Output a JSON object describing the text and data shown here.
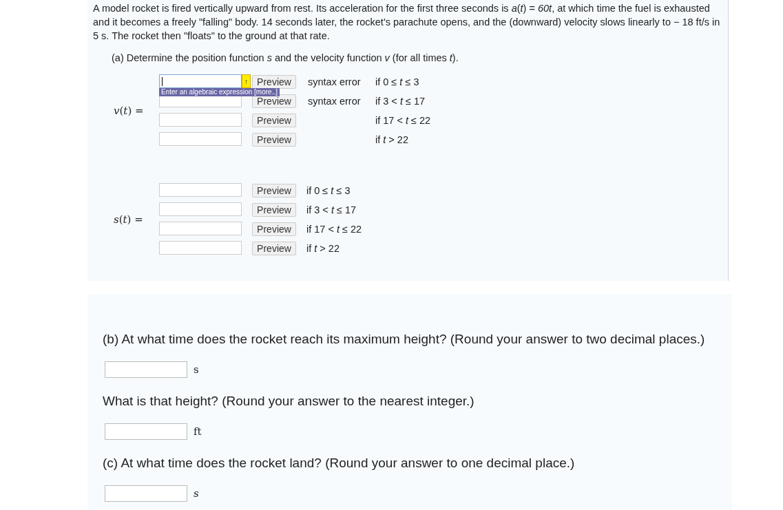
{
  "intro": "A model rocket is fired vertically upward from rest. Its acceleration for the first three seconds is *a*(*t*) = *60t*, at which time the fuel is exhausted and it becomes a freely \"falling\" body. 14 seconds later, the rocket's parachute opens, and the (downward) velocity slows linearly to − 18 ft/s in 5 s. The rocket then \"floats\" to the ground at that rate.",
  "part_a": {
    "question": "(a) Determine the position function *s* and the velocity function *v* (for all times *t*).",
    "groups": [
      {
        "label": "*v*(*t*) =",
        "status_column": true,
        "rows": [
          {
            "focused": true,
            "status": "syntax error",
            "condition": "if 0 ≤ *t* ≤ 3",
            "preview": "Preview"
          },
          {
            "focused": false,
            "status": "syntax error",
            "condition": "if 3 < *t* ≤ 17",
            "preview": "Preview"
          },
          {
            "focused": false,
            "condition": "if 17 < *t* ≤ 22",
            "preview": "Preview"
          },
          {
            "focused": false,
            "condition": "if *t* > 22",
            "preview": "Preview"
          }
        ]
      },
      {
        "label": "*s*(*t*) =",
        "status_column": false,
        "rows": [
          {
            "focused": false,
            "condition": "if 0 ≤ *t* ≤ 3",
            "preview": "Preview"
          },
          {
            "focused": false,
            "condition": "if 3 < *t* ≤ 17",
            "preview": "Preview"
          },
          {
            "focused": false,
            "condition": "if 17 < *t* ≤ 22",
            "preview": "Preview"
          },
          {
            "focused": false,
            "condition": "if *t* > 22",
            "preview": "Preview"
          }
        ]
      }
    ],
    "hint_button": "↑",
    "tooltip": {
      "text": "Enter an algebraic expression",
      "link": "[more..]"
    }
  },
  "questions": [
    {
      "text": "(b) At what time does the rocket reach its maximum height? (Round your answer to two decimal places.)",
      "unit": "s",
      "unit_italic": false
    },
    {
      "text": "What is that height? (Round your answer to the nearest integer.)",
      "unit": "ft",
      "unit_italic": false
    },
    {
      "text": "(c) At what time does the rocket land? (Round your answer to one decimal place.)",
      "unit": "s",
      "unit_italic": true
    }
  ]
}
